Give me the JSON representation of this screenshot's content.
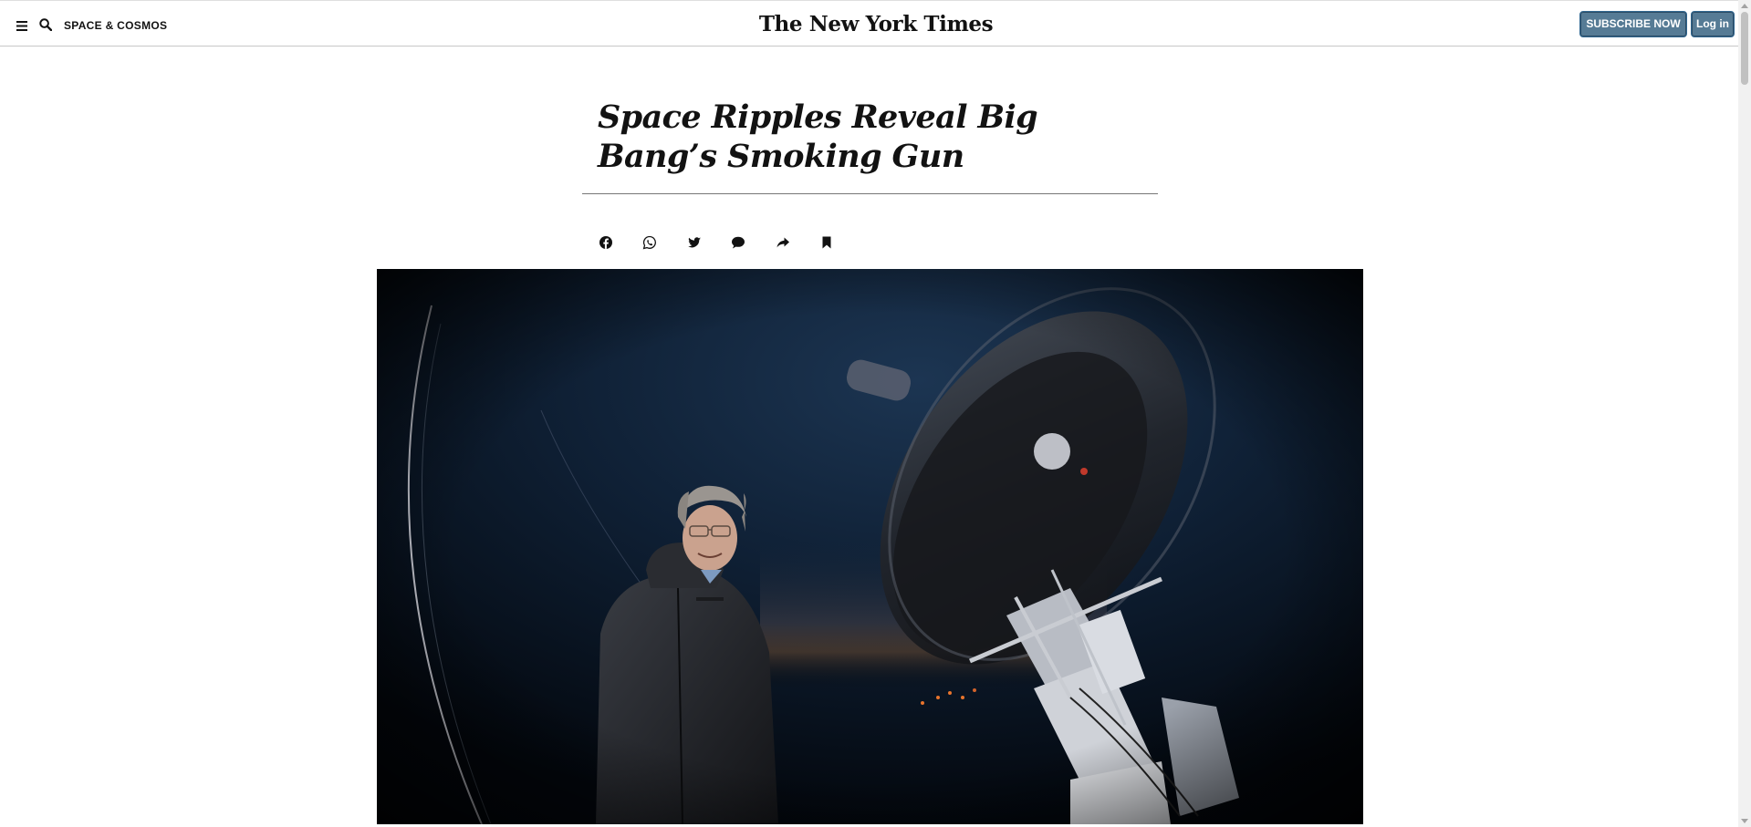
{
  "header": {
    "section": "SPACE & COSMOS",
    "masthead": "The New York Times",
    "subscribe_label": "SUBSCRIBE NOW",
    "login_label": "Log in"
  },
  "article": {
    "headline": "Space Ripples Reveal Big Bang’s Smoking Gun"
  },
  "share_tools": [
    {
      "icon": "facebook-icon"
    },
    {
      "icon": "whatsapp-icon"
    },
    {
      "icon": "twitter-icon"
    },
    {
      "icon": "comment-icon"
    },
    {
      "icon": "share-icon"
    },
    {
      "icon": "bookmark-icon"
    }
  ],
  "colors": {
    "button_bg": "#567b95",
    "text": "#121212",
    "rule": "#767676"
  }
}
